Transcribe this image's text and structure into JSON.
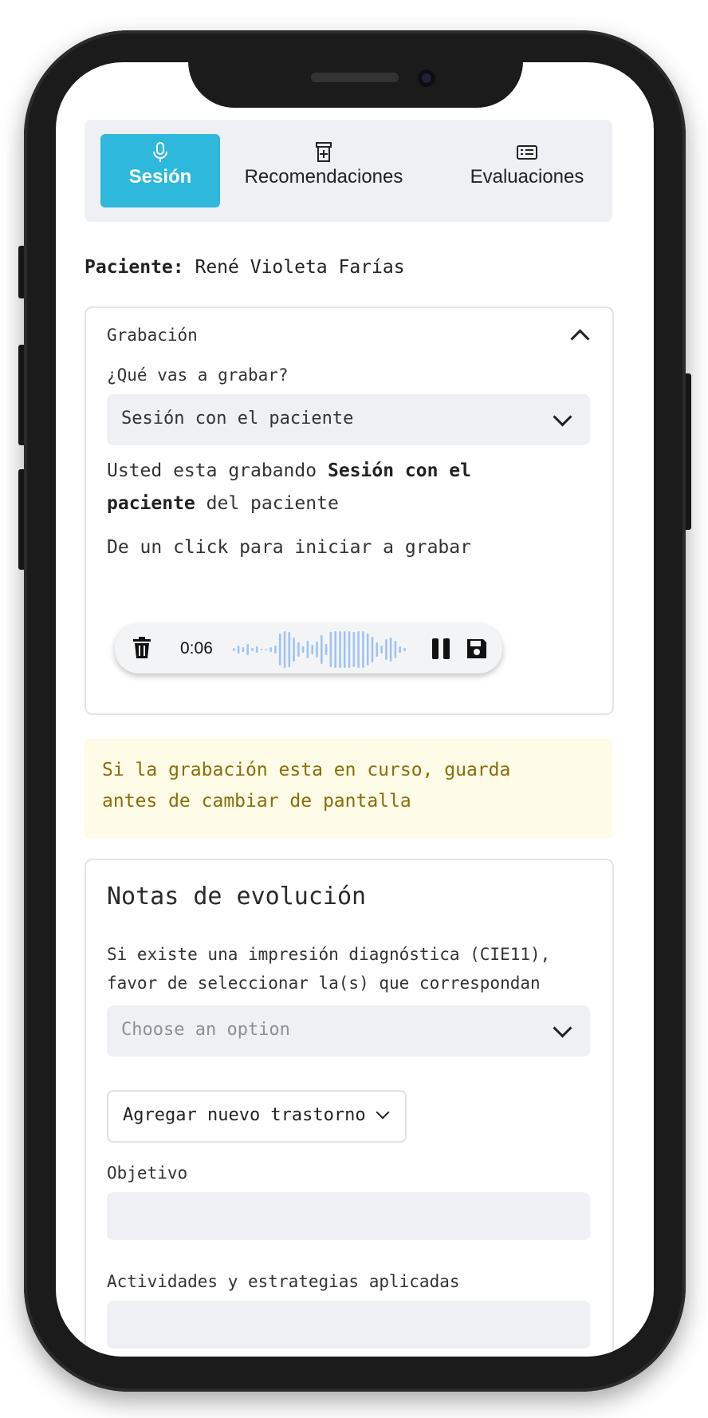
{
  "tabs": [
    {
      "label": "Sesión",
      "icon": "microphone-icon",
      "active": true
    },
    {
      "label": "Recomendaciones",
      "icon": "prescription-bottle-icon",
      "active": false
    },
    {
      "label": "Evaluaciones",
      "icon": "id-card-icon",
      "active": false
    }
  ],
  "patient": {
    "label": "Paciente:",
    "name": "René Violeta Farías"
  },
  "recording": {
    "section_title": "Grabación",
    "question": "¿Qué vas a grabar?",
    "selected": "Sesión con el paciente",
    "status_prefix": "Usted esta grabando",
    "status_bold_1": "Sesión con el",
    "status_bold_2": "paciente",
    "status_suffix": "del paciente",
    "hint": "De un click para iniciar a grabar",
    "time": "0:06"
  },
  "warning": {
    "line1": "Si la grabación esta en curso, guarda",
    "line2": "antes de cambiar de pantalla"
  },
  "notes": {
    "title": "Notas de evolución",
    "desc_line1": "Si existe una impresión diagnóstica (CIE11),",
    "desc_line2": "favor de seleccionar la(s) que correspondan",
    "select_placeholder": "Choose an option",
    "add_button": "Agregar nuevo trastorno",
    "field1_label": "Objetivo",
    "field2_label": "Actividades y estrategias aplicadas"
  },
  "colors": {
    "accent": "#2eb8dc",
    "warning_bg": "#fefbe6",
    "warning_text": "#8a6d0b",
    "wave": "#9ec3f4"
  }
}
